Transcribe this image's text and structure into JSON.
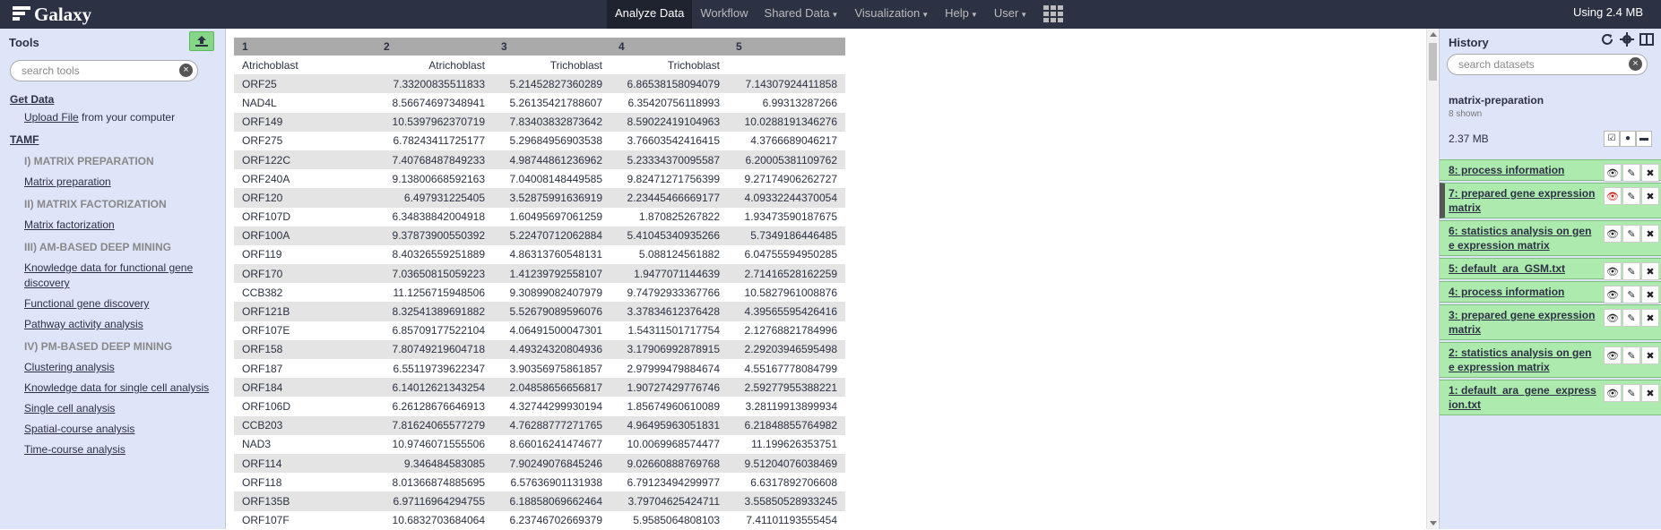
{
  "masthead": {
    "brand": "Galaxy",
    "nav": [
      {
        "label": "Analyze Data",
        "active": true,
        "dropdown": false
      },
      {
        "label": "Workflow",
        "active": false,
        "dropdown": false
      },
      {
        "label": "Shared Data",
        "active": false,
        "dropdown": true
      },
      {
        "label": "Visualization",
        "active": false,
        "dropdown": true
      },
      {
        "label": "Help",
        "active": false,
        "dropdown": true
      },
      {
        "label": "User",
        "active": false,
        "dropdown": true
      }
    ],
    "quota": "Using 2.4 MB"
  },
  "tools": {
    "title": "Tools",
    "search_placeholder": "search tools",
    "get_data": "Get Data",
    "upload_link": "Upload File",
    "upload_suffix": " from your computer",
    "tamf": "TAMF",
    "entries": [
      {
        "kind": "label",
        "text": "I) MATRIX PREPARATION"
      },
      {
        "kind": "tool",
        "text": "Matrix preparation"
      },
      {
        "kind": "label",
        "text": "II) MATRIX FACTORIZATION"
      },
      {
        "kind": "tool",
        "text": "Matrix factorization"
      },
      {
        "kind": "label",
        "text": "III) AM-BASED DEEP MINING"
      },
      {
        "kind": "tool",
        "text": "Knowledge data for functional gene discovery"
      },
      {
        "kind": "tool",
        "text": "Functional gene discovery"
      },
      {
        "kind": "tool",
        "text": "Pathway activity analysis"
      },
      {
        "kind": "label",
        "text": "IV) PM-BASED DEEP MINING"
      },
      {
        "kind": "tool",
        "text": "Clustering analysis"
      },
      {
        "kind": "tool",
        "text": "Knowledge data for single cell analysis"
      },
      {
        "kind": "tool",
        "text": "Single cell analysis"
      },
      {
        "kind": "tool",
        "text": "Spatial-course analysis"
      },
      {
        "kind": "tool",
        "text": "Time-course analysis"
      }
    ]
  },
  "table": {
    "headers": [
      "1",
      "2",
      "3",
      "4",
      "5"
    ],
    "rows": [
      [
        "Atrichoblast",
        "Atrichoblast",
        "Trichoblast",
        "Trichoblast",
        ""
      ],
      [
        "ORF25",
        "7.33200835511833",
        "5.21452827360289",
        "6.86538158094079",
        "7.14307924411858"
      ],
      [
        "NAD4L",
        "8.56674697348941",
        "5.26135421788607",
        "6.35420756118993",
        "6.99313287266"
      ],
      [
        "ORF149",
        "10.5397962370719",
        "7.83403832873642",
        "8.59022419104963",
        "10.0288191346276"
      ],
      [
        "ORF275",
        "6.78243411725177",
        "5.29684956903538",
        "3.76603542416415",
        "4.3766689046217"
      ],
      [
        "ORF122C",
        "7.40768487849233",
        "4.98744861236962",
        "5.23334370095587",
        "6.20005381109762"
      ],
      [
        "ORF240A",
        "9.13800668592163",
        "7.04008148449585",
        "9.82471271756399",
        "9.27174906262727"
      ],
      [
        "ORF120",
        "6.497931225405",
        "3.52875991636919",
        "2.23445466669177",
        "4.09332244370054"
      ],
      [
        "ORF107D",
        "6.34838842004918",
        "1.60495697061259",
        "1.870825267822",
        "1.93473590187675"
      ],
      [
        "ORF100A",
        "9.37873900550392",
        "5.22470712062884",
        "5.41045340935266",
        "5.7349186446485"
      ],
      [
        "ORF119",
        "8.40326559251889",
        "4.86313760548131",
        "5.088124561882",
        "6.04755594950285"
      ],
      [
        "ORF170",
        "7.03650815059223",
        "1.41239792558107",
        "1.9477071144639",
        "2.71416528162259"
      ],
      [
        "CCB382",
        "11.1256715948506",
        "9.30899082407979",
        "9.74792933367766",
        "10.5827961008876"
      ],
      [
        "ORF121B",
        "8.32541389691882",
        "5.52679089596076",
        "3.37834612376428",
        "4.39565595426416"
      ],
      [
        "ORF107E",
        "6.85709177522104",
        "4.06491500047301",
        "1.54311501717754",
        "2.12768821784996"
      ],
      [
        "ORF158",
        "7.80749219604718",
        "4.49324320804936",
        "3.17906992878915",
        "2.29203946595498"
      ],
      [
        "ORF187",
        "6.55119739622347",
        "3.90356975861857",
        "2.97999479884674",
        "4.55167778084799"
      ],
      [
        "ORF184",
        "6.14012621343254",
        "2.04858656656817",
        "1.90727429776746",
        "2.59277955388221"
      ],
      [
        "ORF106D",
        "6.26128676646913",
        "4.32744299930194",
        "1.85674960610089",
        "3.28119913899934"
      ],
      [
        "CCB203",
        "7.81624065577279",
        "4.76288777271765",
        "4.96495963051831",
        "6.21848855764982"
      ],
      [
        "NAD3",
        "10.9746071555506",
        "8.66016241474677",
        "10.0069968574477",
        "11.199626353751"
      ],
      [
        "ORF114",
        "9.346484583085",
        "7.90249076845246",
        "9.02660888769768",
        "9.51204076038469"
      ],
      [
        "ORF118",
        "8.01366874885695",
        "6.57636901131938",
        "6.79123494299977",
        "6.6317892706608"
      ],
      [
        "ORF135B",
        "6.97116964294755",
        "6.18858069662464",
        "3.79704625424711",
        "3.55850528933245"
      ],
      [
        "ORF107F",
        "10.6832703684064",
        "6.23746702669379",
        "5.9585064808103",
        "7.41101193555454"
      ]
    ]
  },
  "history": {
    "title": "History",
    "search_placeholder": "search datasets",
    "name": "matrix-preparation",
    "shown": "8 shown",
    "size": "2.37 MB",
    "datasets": [
      {
        "title": "8: process information",
        "selected": false
      },
      {
        "title": "7: prepared gene expression matrix",
        "selected": true
      },
      {
        "title": "6: statistics analysis on gene expression matrix",
        "selected": false
      },
      {
        "title": "5: default_ara_GSM.txt",
        "selected": false
      },
      {
        "title": "4: process information",
        "selected": false
      },
      {
        "title": "3: prepared gene expression matrix",
        "selected": false
      },
      {
        "title": "2: statistics analysis on gene expression matrix",
        "selected": false
      },
      {
        "title": "1: default_ara_gene_expression.txt",
        "selected": false
      }
    ]
  }
}
